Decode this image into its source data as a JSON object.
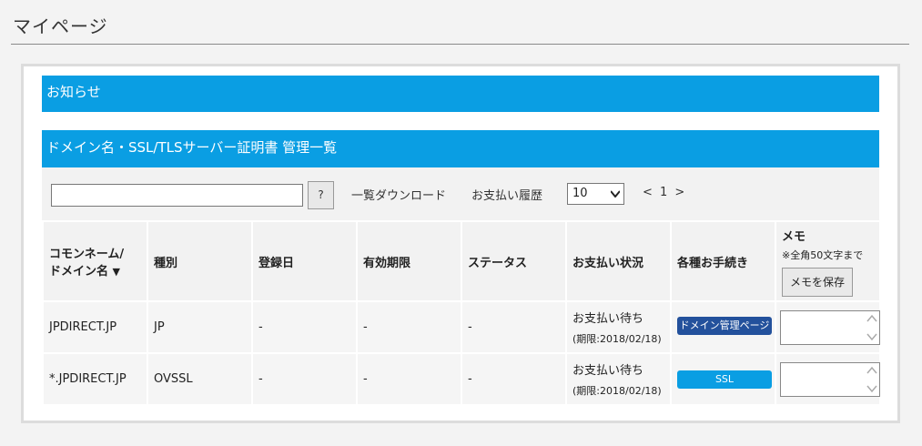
{
  "page": {
    "title": "マイページ"
  },
  "notice": {
    "title": "お知らせ"
  },
  "domain_list": {
    "title": "ドメイン名・SSL/TLSサーバー証明書 管理一覧",
    "search": {
      "value": "",
      "placeholder": "",
      "button_label": "?"
    },
    "download_label": "一覧ダウンロード",
    "history_label": "お支払い履歴",
    "per_page": "10",
    "pager": "< 1 >",
    "columns": {
      "common_name_line1": "コモンネーム/",
      "common_name_line2": "ドメイン名",
      "sort_mark": "▼",
      "type": "種別",
      "registered": "登録日",
      "expires": "有効期限",
      "status": "ステータス",
      "payment": "お支払い状況",
      "procedures": "各種お手続き",
      "memo": "メモ",
      "memo_note": "※全角50文字まで",
      "memo_save": "メモを保存"
    },
    "rows": [
      {
        "name": "JPDIRECT.JP",
        "type": "JP",
        "registered": "-",
        "expires": "-",
        "status": "-",
        "payment_status": "お支払い待ち",
        "payment_deadline": "(期限:2018/02/18)",
        "action_label": "ドメイン管理ページ",
        "memo": ""
      },
      {
        "name": "*.JPDIRECT.JP",
        "type": "OVSSL",
        "registered": "-",
        "expires": "-",
        "status": "-",
        "payment_status": "お支払い待ち",
        "payment_deadline": "(期限:2018/02/18)",
        "action_label": "SSL",
        "memo": ""
      }
    ]
  },
  "colors": {
    "accent": "#0a9ee3",
    "domain_button": "#23519c"
  }
}
